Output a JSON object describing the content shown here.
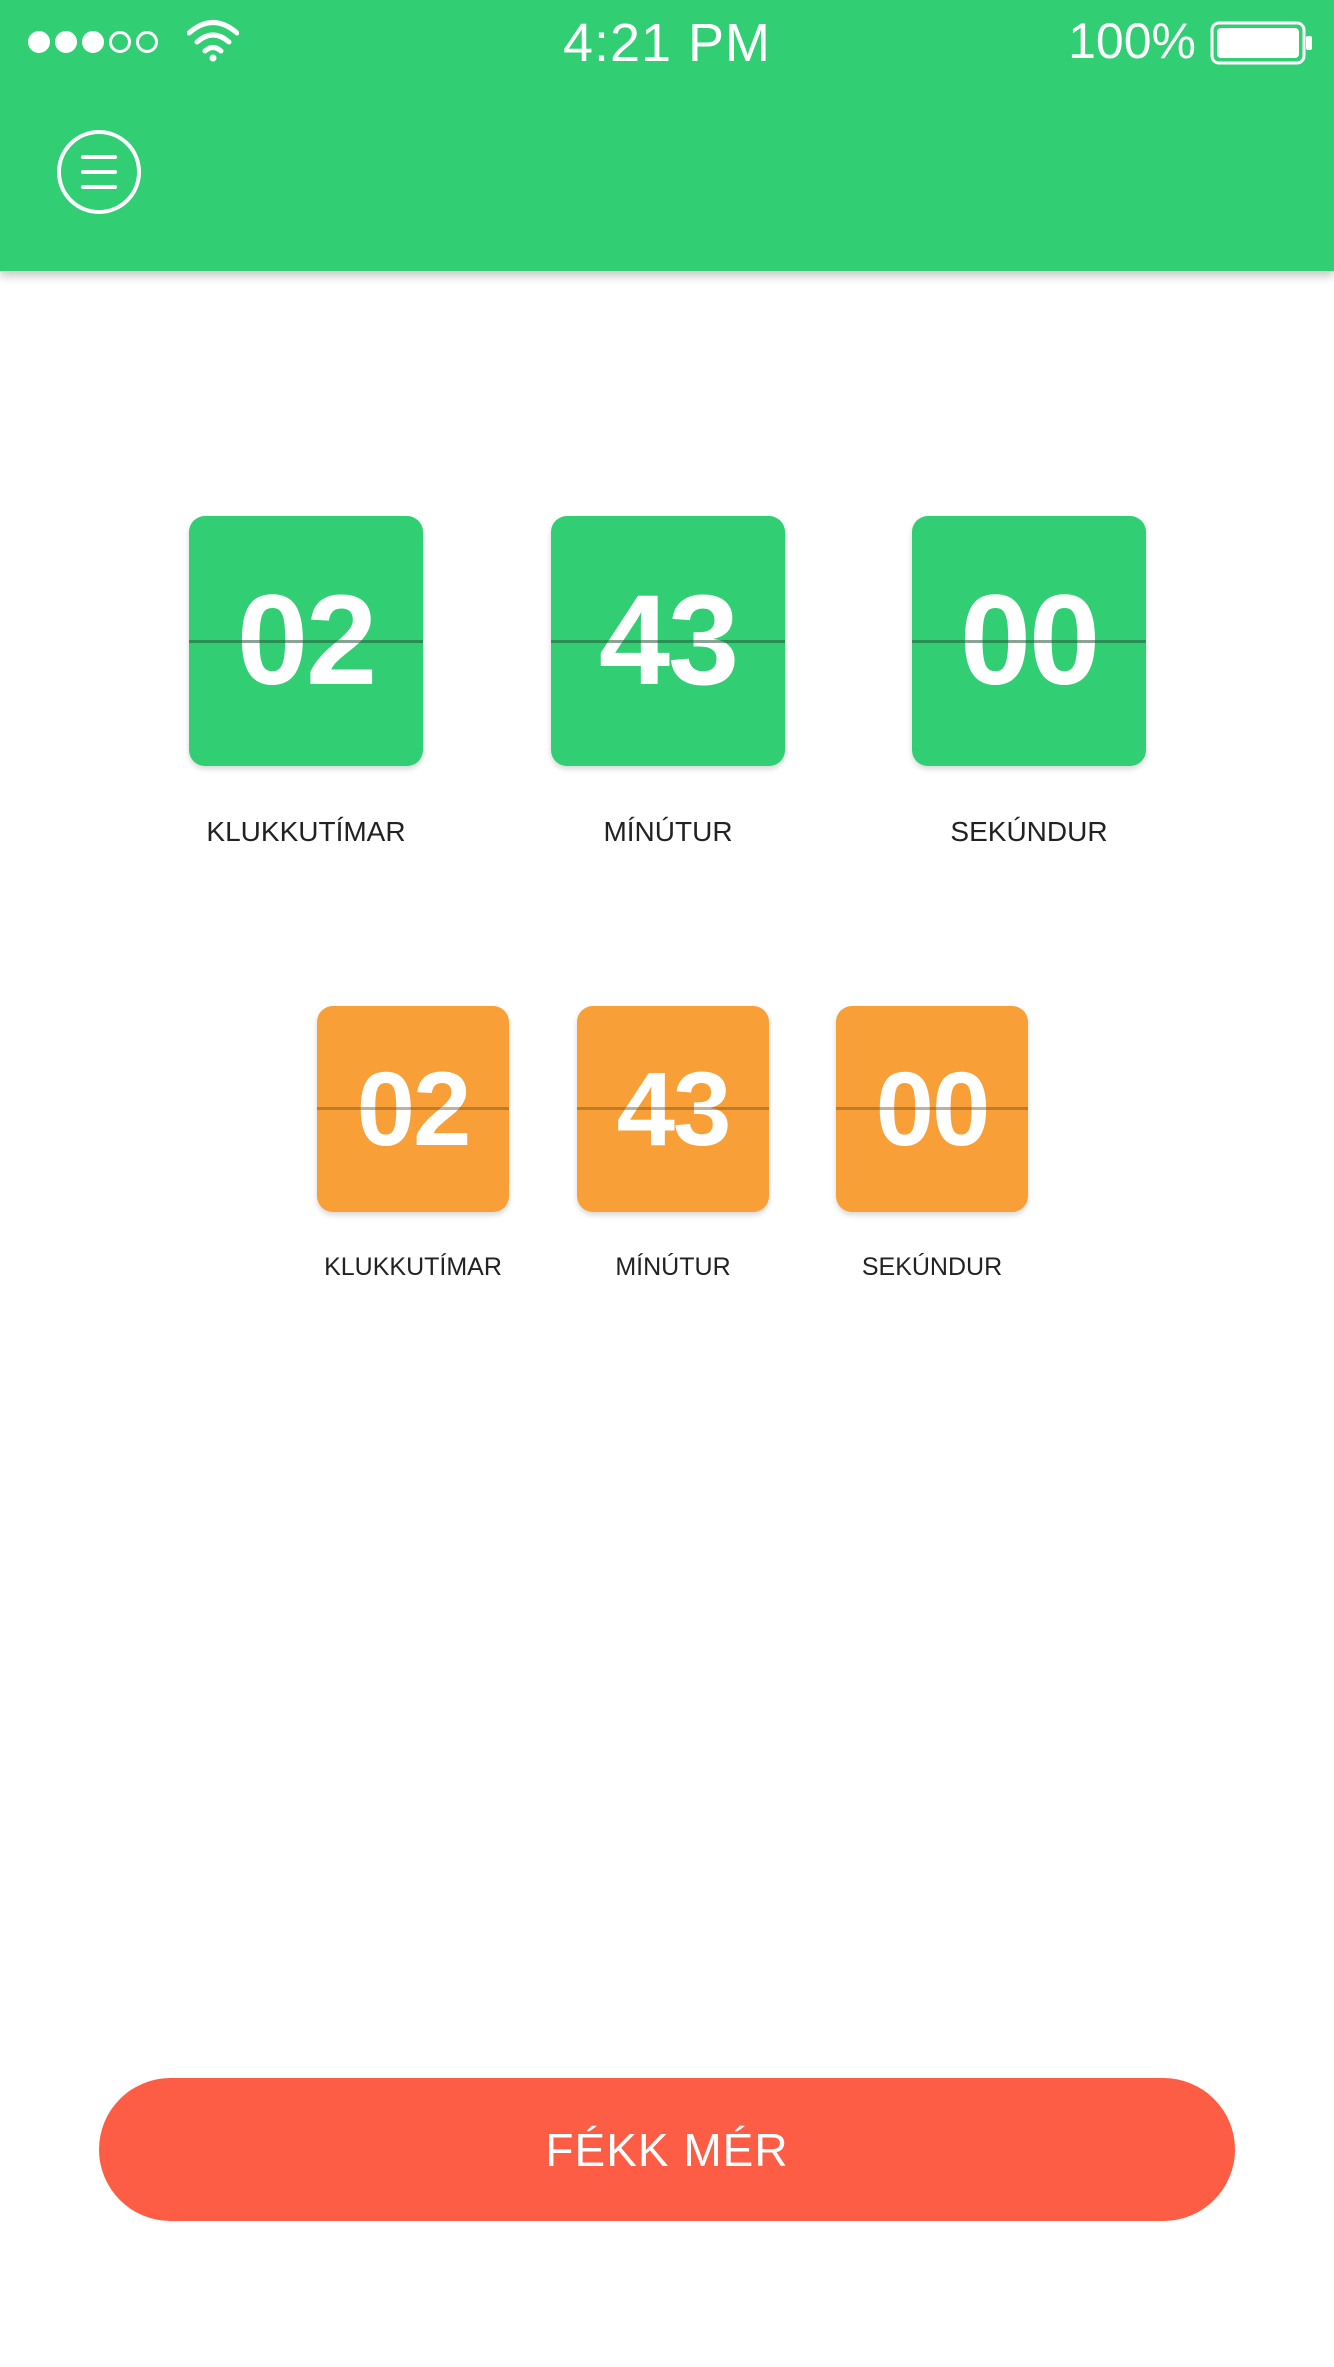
{
  "status_bar": {
    "time": "4:21 PM",
    "battery_percent": "100%",
    "signal_bars_filled": 3,
    "signal_bars_total": 5,
    "icons": [
      "wifi-icon",
      "battery-icon"
    ]
  },
  "header": {
    "color": "#31CE73",
    "menu_icon": "hamburger-menu-icon"
  },
  "primary_timer": {
    "color": "#31CE73",
    "units": [
      {
        "value": "02",
        "label": "KLUKKUTÍMAR"
      },
      {
        "value": "43",
        "label": "MÍNÚTUR"
      },
      {
        "value": "00",
        "label": "SEKÚNDUR"
      }
    ]
  },
  "secondary_timer": {
    "color": "#F89F38",
    "units": [
      {
        "value": "02",
        "label": "KLUKKUTÍMAR"
      },
      {
        "value": "43",
        "label": "MÍNÚTUR"
      },
      {
        "value": "00",
        "label": "SEKÚNDUR"
      }
    ]
  },
  "action_button": {
    "label": "FÉKK MÉR",
    "color": "#FE5D45"
  }
}
